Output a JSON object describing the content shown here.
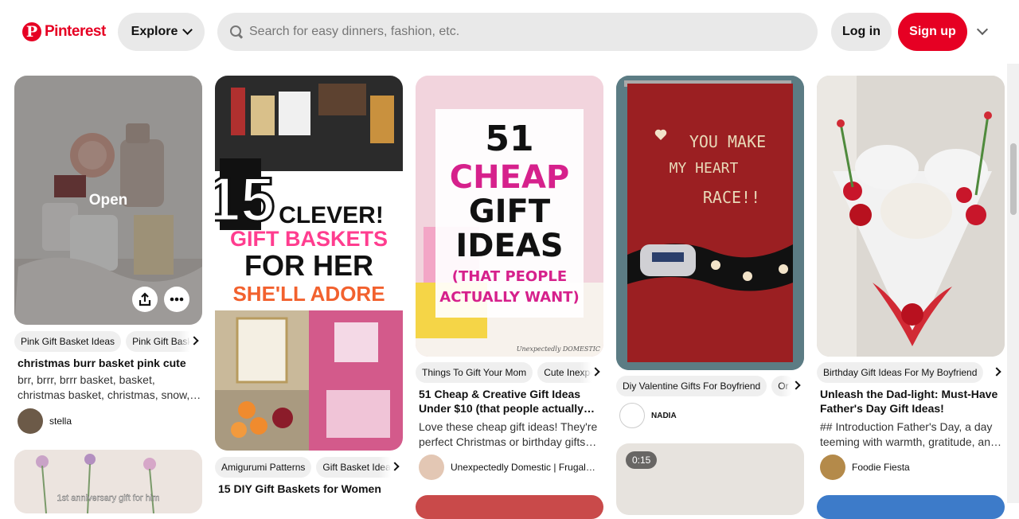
{
  "header": {
    "logo_text": "Pinterest",
    "explore_label": "Explore",
    "search_placeholder": "Search for easy dinners, fashion, etc.",
    "login_label": "Log in",
    "signup_label": "Sign up"
  },
  "colors": {
    "brand": "#e60023",
    "chip": "#efefef"
  },
  "pins": [
    {
      "open_label": "Open",
      "tags": [
        "Pink Gift Basket Ideas",
        "Pink Gift Basket"
      ],
      "title": "christmas burr basket pink cute",
      "description": "brr, brrr, brrr basket, basket, christmas basket, christmas, snow,…",
      "creator": "stella"
    },
    {
      "image_text": {
        "line1": "15",
        "line2": "CLEVER!",
        "line3": "GIFT BASKETS",
        "line4": "FOR HER",
        "line5": "SHE'LL ADORE"
      },
      "tags": [
        "Amigurumi Patterns",
        "Gift Basket Ideas"
      ],
      "title": "15 DIY Gift Baskets for Women"
    },
    {
      "image_text": {
        "line1": "51",
        "line2": "CHEAP",
        "line3": "GIFT",
        "line4": "IDEAS",
        "line5": "(THAT PEOPLE",
        "line6": "ACTUALLY WANT)",
        "watermark": "Unexpectedly DOMESTIC"
      },
      "tags": [
        "Things To Gift Your Mom",
        "Cute Inexpensive"
      ],
      "title": "51 Cheap & Creative Gift Ideas Under $10 (that people actually…",
      "description": "Love these cheap gift ideas! They're perfect Christmas or birthday gifts…",
      "creator": "Unexpectedly Domestic | Frugal…"
    },
    {
      "image_text": {
        "line1": "YOU MAKE",
        "line2": "MY HEART",
        "line3": "RACE!!"
      },
      "tags": [
        "Diy Valentine Gifts For Boyfriend",
        "Or"
      ],
      "creator": "NADIA",
      "next_video_time": "0:15"
    },
    {
      "tags": [
        "Birthday Gift Ideas For My Boyfriend"
      ],
      "title": "Unleash the Dad-light: Must-Have Father's Day Gift Ideas!",
      "description": "## Introduction Father's Day, a day teeming with warmth, gratitude, an…",
      "creator": "Foodie Fiesta"
    }
  ],
  "lower_pins": {
    "anniversary_caption": "1st anniversary gift for him"
  }
}
